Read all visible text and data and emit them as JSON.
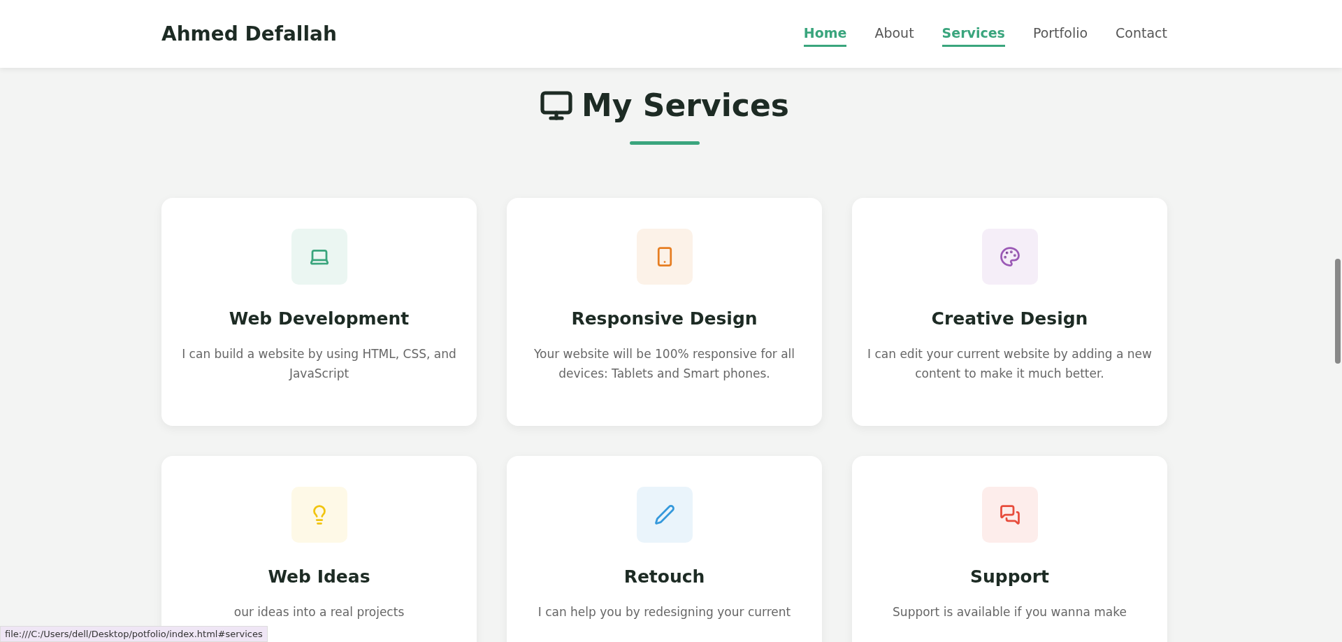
{
  "header": {
    "brand": "Ahmed Defallah",
    "nav": [
      {
        "label": "Home",
        "selected": true
      },
      {
        "label": "About",
        "selected": false
      },
      {
        "label": "Services",
        "selected": true
      },
      {
        "label": "Portfolio",
        "selected": false
      },
      {
        "label": "Contact",
        "selected": false
      }
    ]
  },
  "section": {
    "title": "My Services",
    "cards": [
      {
        "kind": "laptop",
        "color": "#3aa57d",
        "title": "Web Development",
        "description": "I can build a website by using HTML, CSS, and JavaScript"
      },
      {
        "kind": "phone",
        "color": "#e67e22",
        "title": "Responsive Design",
        "description": "Your website will be 100% responsive for all devices: Tablets and Smart phones."
      },
      {
        "kind": "palette",
        "color": "#9b59b6",
        "title": "Creative Design",
        "description": "I can edit your current website by adding a new content to make it much better."
      },
      {
        "kind": "bulb",
        "color": "#f1c40f",
        "title": "Web Ideas",
        "description": "our ideas into a real projects"
      },
      {
        "kind": "pen",
        "color": "#3498db",
        "title": "Retouch",
        "description": "I can help you by redesigning your current"
      },
      {
        "kind": "chat",
        "color": "#e74c3c",
        "title": "Support",
        "description": "Support is available if you wanna make"
      }
    ]
  },
  "status_bar": {
    "url": "file:///C:/Users/dell/Desktop/potfolio/index.html#services"
  }
}
